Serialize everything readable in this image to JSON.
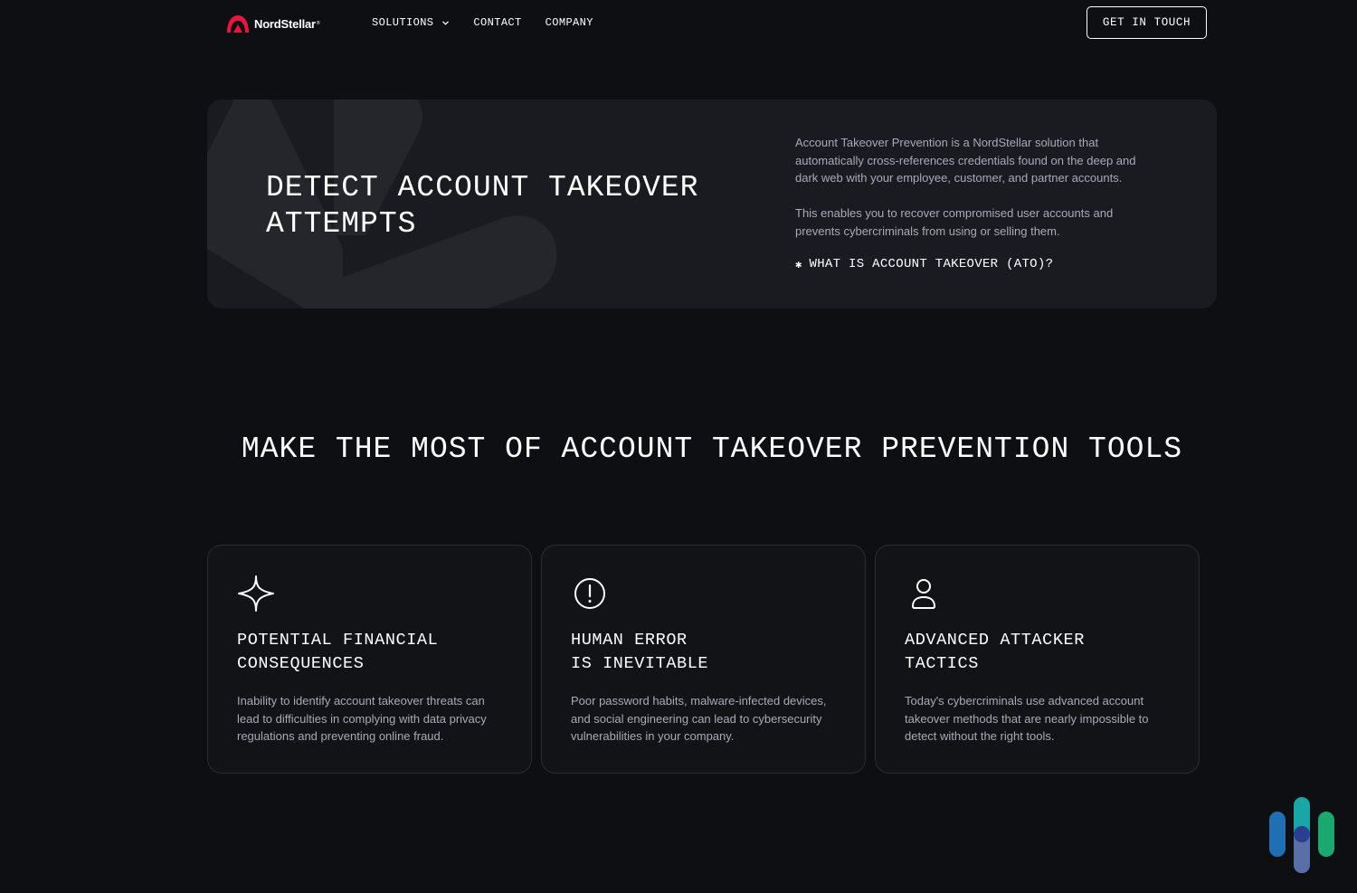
{
  "nav": {
    "brand": "NordStellar",
    "brand_mark": "®",
    "links": [
      {
        "label": "SOLUTIONS",
        "has_dropdown": true
      },
      {
        "label": "CONTACT",
        "has_dropdown": false
      },
      {
        "label": "COMPANY",
        "has_dropdown": false
      }
    ],
    "cta_label": "GET IN TOUCH"
  },
  "hero": {
    "title_line1": "DETECT ACCOUNT TAKEOVER",
    "title_line2": "ATTEMPTS",
    "paragraph1": "Account Takeover Prevention is a NordStellar solution that automatically cross-references credentials found on the deep and dark web with your employee, customer, and partner accounts.",
    "paragraph2": "This enables you to recover compromised user accounts and prevents cybercriminals from using or selling them.",
    "link_label": "WHAT IS ACCOUNT TAKEOVER (ATO)?"
  },
  "section": {
    "title": "MAKE THE MOST OF ACCOUNT TAKEOVER PREVENTION TOOLS"
  },
  "cards": [
    {
      "icon": "sparkle-icon",
      "title_line1": "POTENTIAL FINANCIAL",
      "title_line2": "CONSEQUENCES",
      "body": "Inability to identify account takeover threats can lead to difficulties in complying with data privacy regulations and preventing online fraud."
    },
    {
      "icon": "alert-circle-icon",
      "title_line1": "HUMAN ERROR",
      "title_line2": "IS INEVITABLE",
      "body": "Poor password habits, malware-infected devices, and social engineering can lead to cybersecurity vulnerabilities in your company."
    },
    {
      "icon": "user-icon",
      "title_line1": "ADVANCED ATTACKER",
      "title_line2": "TACTICS",
      "body": "Today's cybercriminals use advanced account takeover methods that are nearly impossible to detect without the right tools."
    }
  ],
  "colors": {
    "background": "#0e0f12",
    "hero_panel": "#1a1b20",
    "muted_text": "#a8abb4",
    "brand_red": "#e4173e",
    "widget_blue": "#1f6fb2",
    "widget_teal": "#1aa6a6",
    "widget_green": "#1aa86f",
    "widget_navy": "#2a3f8f"
  }
}
